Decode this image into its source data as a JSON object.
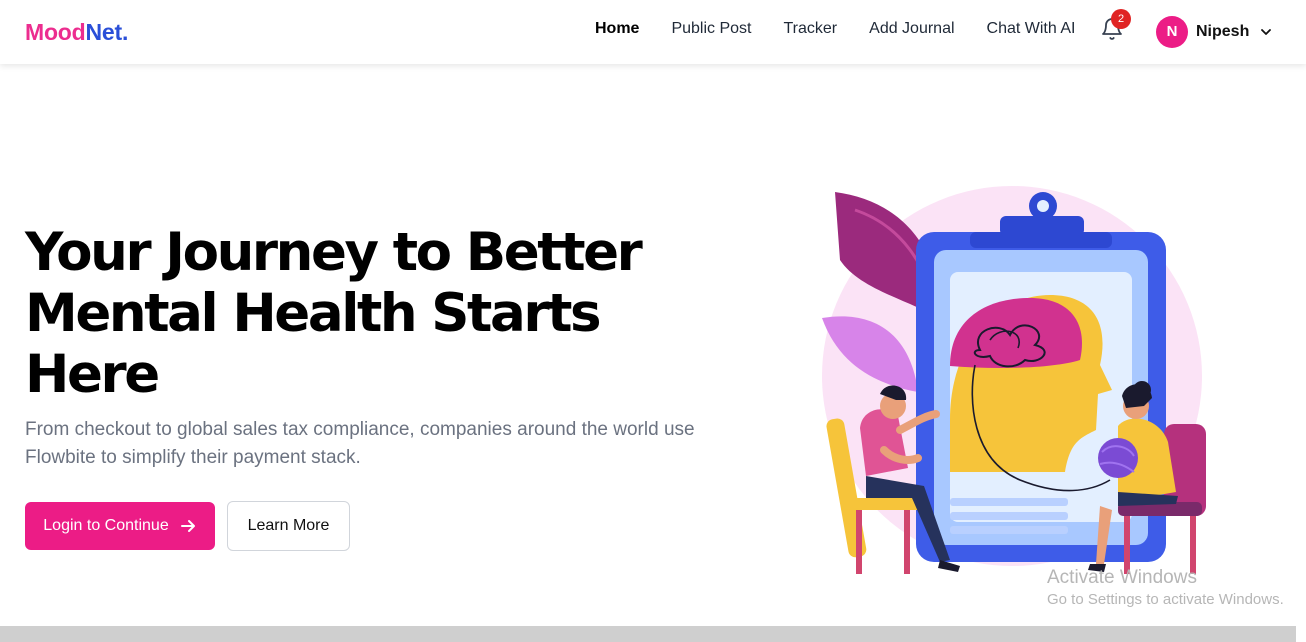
{
  "brand": {
    "part1": "Mood",
    "part2": "Net."
  },
  "nav": {
    "items": [
      {
        "label": "Home",
        "active": true
      },
      {
        "label": "Public Post",
        "active": false
      },
      {
        "label": "Tracker",
        "active": false
      },
      {
        "label": "Add Journal",
        "active": false
      },
      {
        "label": "Chat With AI",
        "active": false
      }
    ],
    "notification_count": "2",
    "user": {
      "initial": "N",
      "name": "Nipesh"
    }
  },
  "hero": {
    "title_lines": [
      "Your Journey to Better",
      "Mental Health Starts",
      "Here"
    ],
    "subtitle": "From checkout to global sales tax compliance, companies around the world use Flowbite to simplify their payment stack.",
    "primary_button": "Login to Continue",
    "secondary_button": "Learn More"
  },
  "watermark": {
    "title": "Activate Windows",
    "subtitle": "Go to Settings to activate Windows."
  },
  "colors": {
    "brand_pink": "#ec1c86",
    "brand_blue": "#2a4fd8",
    "badge_red": "#e02424"
  },
  "icons": {
    "bell": "bell-icon",
    "chevron": "chevron-down-icon",
    "arrow": "arrow-right-icon"
  }
}
